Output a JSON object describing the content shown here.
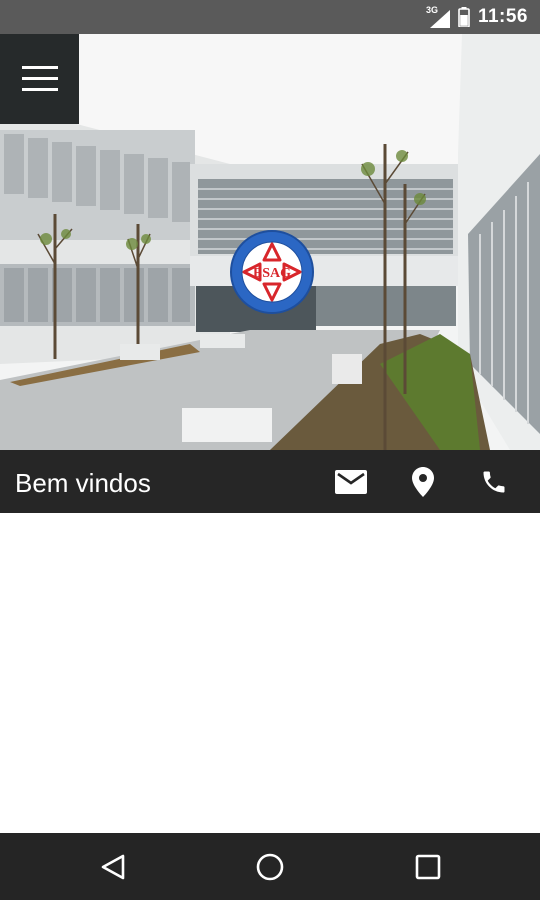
{
  "status_bar": {
    "network_type": "3G",
    "time": "11:56"
  },
  "header": {
    "title": "Bem vindos"
  },
  "hero": {
    "logo_text": "ESAG",
    "logo_ring_text": "ESCOLA SECUNDÁRIA"
  },
  "actions": {
    "mail_icon": "mail-icon",
    "location_icon": "location-pin-icon",
    "phone_icon": "phone-icon"
  },
  "colors": {
    "status_bar": "#5a5a5a",
    "title_bar": "#262626",
    "menu_button": "#262a2b",
    "nav_bar": "#252525",
    "logo_blue": "#2b67c4",
    "logo_red": "#d8262b"
  }
}
